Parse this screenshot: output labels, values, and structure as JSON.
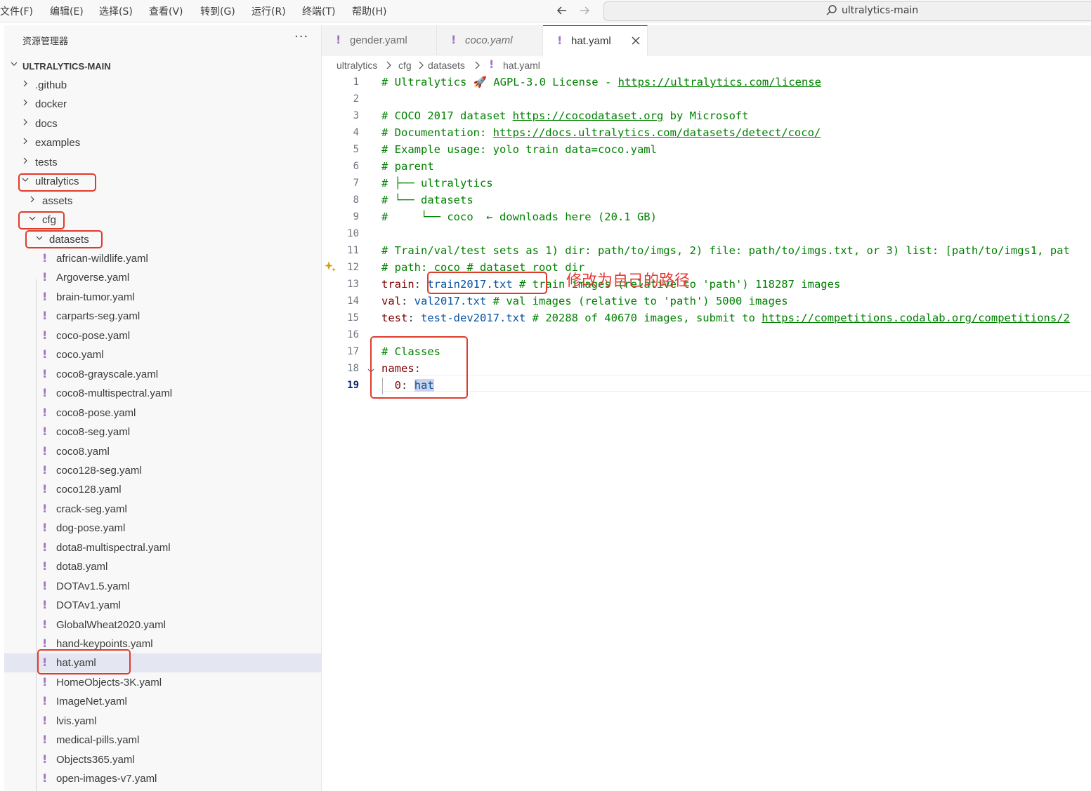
{
  "menubar": {
    "items": [
      "文件(F)",
      "编辑(E)",
      "选择(S)",
      "查看(V)",
      "转到(G)",
      "运行(R)",
      "终端(T)",
      "帮助(H)"
    ],
    "search_label": "ultralytics-main"
  },
  "sidebar": {
    "header": "资源管理器",
    "more": "···",
    "root": "ULTRALYTICS-MAIN",
    "folders": [
      ".github",
      "docker",
      "docs",
      "examples",
      "tests"
    ],
    "ultralytics": "ultralytics",
    "assets": "assets",
    "cfg": "cfg",
    "datasets": "datasets",
    "files": [
      "african-wildlife.yaml",
      "Argoverse.yaml",
      "brain-tumor.yaml",
      "carparts-seg.yaml",
      "coco-pose.yaml",
      "coco.yaml",
      "coco8-grayscale.yaml",
      "coco8-multispectral.yaml",
      "coco8-pose.yaml",
      "coco8-seg.yaml",
      "coco8.yaml",
      "coco128-seg.yaml",
      "coco128.yaml",
      "crack-seg.yaml",
      "dog-pose.yaml",
      "dota8-multispectral.yaml",
      "dota8.yaml",
      "DOTAv1.5.yaml",
      "DOTAv1.yaml",
      "GlobalWheat2020.yaml",
      "hand-keypoints.yaml",
      "hat.yaml",
      "HomeObjects-3K.yaml",
      "ImageNet.yaml",
      "lvis.yaml",
      "medical-pills.yaml",
      "Objects365.yaml",
      "open-images-v7.yaml"
    ],
    "selected_index": 21
  },
  "tabs": [
    {
      "label": "gender.yaml"
    },
    {
      "label": "coco.yaml"
    },
    {
      "label": "hat.yaml"
    }
  ],
  "breadcrumb": [
    "ultralytics",
    "cfg",
    "datasets",
    "hat.yaml"
  ],
  "editor": {
    "line_numbers": [
      "1",
      "2",
      "3",
      "4",
      "5",
      "6",
      "7",
      "8",
      "9",
      "10",
      "11",
      "12",
      "13",
      "14",
      "15",
      "16",
      "17",
      "18",
      "19"
    ],
    "l1_a": "# Ultralytics ",
    "l1_rocket": "🚀",
    "l1_b": " AGPL-3.0 License - ",
    "l1_url": "https://ultralytics.com/license",
    "l3_a": "# COCO 2017 dataset ",
    "l3_url": "https://cocodataset.org",
    "l3_b": " by Microsoft",
    "l4_a": "# Documentation: ",
    "l4_url": "https://docs.ultralytics.com/datasets/detect/coco/",
    "l5": "# Example usage: yolo train data=coco.yaml",
    "l6": "# parent",
    "l7": "# ├── ultralytics",
    "l8": "# └── datasets",
    "l9": "#     └── coco  ← downloads here (20.1 GB)",
    "l11": "# Train/val/test sets as 1) dir: path/to/imgs, 2) file: path/to/imgs.txt, or 3) list: [path/to/imgs1, pat",
    "l12": "# path: coco # dataset root dir",
    "l13_key": "train",
    "l13_val": "train2017.txt",
    "l13_cmt": "# train images (relative to 'path') 118287 images",
    "l14_key": "val",
    "l14_val": "val2017.txt",
    "l14_cmt": "# val images (relative to 'path') 5000 images",
    "l15_key": "test",
    "l15_val": "test-dev2017.txt",
    "l15_cmt": "# 20288 of 40670 images, submit to ",
    "l15_url": "https://competitions.codalab.org/competitions/2",
    "l17": "# Classes",
    "l18_key": "names",
    "l19_key": "0",
    "l19_val": "hat"
  },
  "annotation": "修改为自己的路径"
}
